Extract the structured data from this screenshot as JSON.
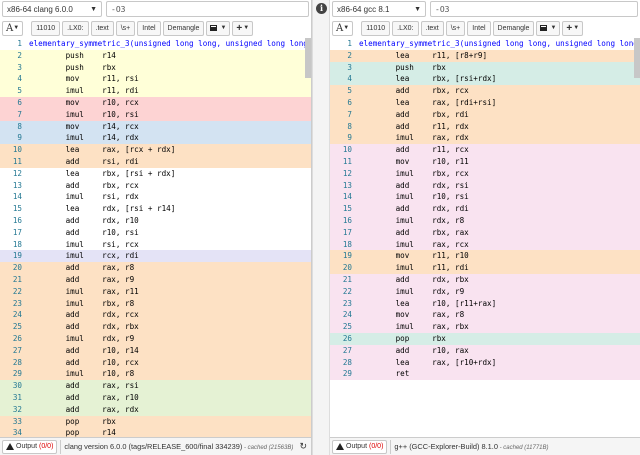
{
  "left": {
    "compiler": "x86-64 clang 6.0.0",
    "options": "-O3",
    "toolbar": {
      "b11010": "11010",
      "lx0": ".LX0:",
      "text": ".text",
      "comments": "\\s+",
      "intel": "Intel",
      "demangle": "Demangle"
    },
    "lines": [
      {
        "n": "1",
        "t": "elementary_symmetric_3(unsigned long long, unsigned long long",
        "bg": "bg-white",
        "first": true
      },
      {
        "n": "2",
        "t": "        push    r14",
        "bg": "bg-yellow"
      },
      {
        "n": "3",
        "t": "        push    rbx",
        "bg": "bg-yellow"
      },
      {
        "n": "4",
        "t": "        mov     r11, rsi",
        "bg": "bg-yellow"
      },
      {
        "n": "5",
        "t": "        imul    r11, rdi",
        "bg": "bg-yellow"
      },
      {
        "n": "6",
        "t": "        mov     r10, rcx",
        "bg": "bg-red"
      },
      {
        "n": "7",
        "t": "        imul    r10, rsi",
        "bg": "bg-red"
      },
      {
        "n": "8",
        "t": "        mov     r14, rcx",
        "bg": "bg-blue"
      },
      {
        "n": "9",
        "t": "        imul    r14, rdx",
        "bg": "bg-blue"
      },
      {
        "n": "10",
        "t": "        lea     rax, [rcx + rdx]",
        "bg": "bg-orange"
      },
      {
        "n": "11",
        "t": "        add     rsi, rdi",
        "bg": "bg-orange"
      },
      {
        "n": "12",
        "t": "        lea     rbx, [rsi + rdx]",
        "bg": "bg-white"
      },
      {
        "n": "13",
        "t": "        add     rbx, rcx",
        "bg": "bg-white"
      },
      {
        "n": "14",
        "t": "        imul    rsi, rdx",
        "bg": "bg-white"
      },
      {
        "n": "15",
        "t": "        lea     rdx, [rsi + r14]",
        "bg": "bg-white"
      },
      {
        "n": "16",
        "t": "        add     rdx, r10",
        "bg": "bg-white"
      },
      {
        "n": "17",
        "t": "        add     r10, rsi",
        "bg": "bg-white"
      },
      {
        "n": "18",
        "t": "        imul    rsi, rcx",
        "bg": "bg-white"
      },
      {
        "n": "19",
        "t": "        imul    rcx, rdi",
        "bg": "bg-lav"
      },
      {
        "n": "20",
        "t": "        add     rax, r8",
        "bg": "bg-orange"
      },
      {
        "n": "21",
        "t": "        add     rax, r9",
        "bg": "bg-orange"
      },
      {
        "n": "22",
        "t": "        imul    rax, r11",
        "bg": "bg-orange"
      },
      {
        "n": "23",
        "t": "        imul    rbx, r8",
        "bg": "bg-orange"
      },
      {
        "n": "24",
        "t": "        add     rdx, rcx",
        "bg": "bg-orange"
      },
      {
        "n": "25",
        "t": "        add     rdx, rbx",
        "bg": "bg-orange"
      },
      {
        "n": "26",
        "t": "        imul    rdx, r9",
        "bg": "bg-orange"
      },
      {
        "n": "27",
        "t": "        add     r10, r14",
        "bg": "bg-orange"
      },
      {
        "n": "28",
        "t": "        add     r10, rcx",
        "bg": "bg-orange"
      },
      {
        "n": "29",
        "t": "        imul    r10, r8",
        "bg": "bg-orange"
      },
      {
        "n": "30",
        "t": "        add     rax, rsi",
        "bg": "bg-green"
      },
      {
        "n": "31",
        "t": "        add     rax, r10",
        "bg": "bg-green"
      },
      {
        "n": "32",
        "t": "        add     rax, rdx",
        "bg": "bg-green"
      },
      {
        "n": "33",
        "t": "        pop     rbx",
        "bg": "bg-orange"
      },
      {
        "n": "34",
        "t": "        pop     r14",
        "bg": "bg-orange"
      },
      {
        "n": "35",
        "t": "        ret",
        "bg": "bg-orange"
      }
    ],
    "status": {
      "output_label": "Output",
      "output_count": "(0/0)",
      "version": "clang version 6.0.0 (tags/RELEASE_600/final 334239)",
      "cached": " - cached (21563B)"
    }
  },
  "right": {
    "compiler": "x86-64 gcc 8.1",
    "options": "-O3",
    "toolbar": {
      "b11010": "11010",
      "lx0": ".LX0:",
      "text": ".text",
      "comments": "\\s+",
      "intel": "Intel",
      "demangle": "Demangle"
    },
    "lines": [
      {
        "n": "1",
        "t": "elementary_symmetric_3(unsigned long long, unsigned long long",
        "bg": "bg-white",
        "first": true
      },
      {
        "n": "2",
        "t": "        lea     r11, [r8+r9]",
        "bg": "bg-orange"
      },
      {
        "n": "3",
        "t": "        push    rbx",
        "bg": "bg-teal"
      },
      {
        "n": "4",
        "t": "        lea     rbx, [rsi+rdx]",
        "bg": "bg-teal"
      },
      {
        "n": "5",
        "t": "        add     rbx, rcx",
        "bg": "bg-orange"
      },
      {
        "n": "6",
        "t": "        lea     rax, [rdi+rsi]",
        "bg": "bg-orange"
      },
      {
        "n": "7",
        "t": "        add     rbx, rdi",
        "bg": "bg-orange"
      },
      {
        "n": "8",
        "t": "        add     r11, rdx",
        "bg": "bg-orange"
      },
      {
        "n": "9",
        "t": "        imul    rax, rdx",
        "bg": "bg-orange"
      },
      {
        "n": "10",
        "t": "        add     r11, rcx",
        "bg": "bg-pink"
      },
      {
        "n": "11",
        "t": "        mov     r10, r11",
        "bg": "bg-pink"
      },
      {
        "n": "12",
        "t": "        imul    rbx, rcx",
        "bg": "bg-pink"
      },
      {
        "n": "13",
        "t": "        add     rdx, rsi",
        "bg": "bg-pink"
      },
      {
        "n": "14",
        "t": "        imul    r10, rsi",
        "bg": "bg-pink"
      },
      {
        "n": "15",
        "t": "        add     rdx, rdi",
        "bg": "bg-pink"
      },
      {
        "n": "16",
        "t": "        imul    rdx, r8",
        "bg": "bg-pink"
      },
      {
        "n": "17",
        "t": "        add     rbx, rax",
        "bg": "bg-pink"
      },
      {
        "n": "18",
        "t": "        imul    rax, rcx",
        "bg": "bg-pink"
      },
      {
        "n": "19",
        "t": "        mov     r11, r10",
        "bg": "bg-orange"
      },
      {
        "n": "20",
        "t": "        imul    r11, rdi",
        "bg": "bg-orange"
      },
      {
        "n": "21",
        "t": "        add     rdx, rbx",
        "bg": "bg-pink"
      },
      {
        "n": "22",
        "t": "        imul    rdx, r9",
        "bg": "bg-pink"
      },
      {
        "n": "23",
        "t": "        lea     r10, [r11+rax]",
        "bg": "bg-pink"
      },
      {
        "n": "24",
        "t": "        mov     rax, r8",
        "bg": "bg-pink"
      },
      {
        "n": "25",
        "t": "        imul    rax, rbx",
        "bg": "bg-pink"
      },
      {
        "n": "26",
        "t": "        pop     rbx",
        "bg": "bg-teal"
      },
      {
        "n": "27",
        "t": "        add     r10, rax",
        "bg": "bg-pink"
      },
      {
        "n": "28",
        "t": "        lea     rax, [r10+rdx]",
        "bg": "bg-pink"
      },
      {
        "n": "29",
        "t": "        ret",
        "bg": "bg-pink"
      }
    ],
    "status": {
      "output_label": "Output",
      "output_count": "(0/0)",
      "version": "g++ (GCC-Explorer-Build) 8.1.0",
      "cached": " - cached (11771B)"
    }
  },
  "icons": {
    "font_button": "A",
    "filter": "filter-icon",
    "add": "add-icon"
  }
}
